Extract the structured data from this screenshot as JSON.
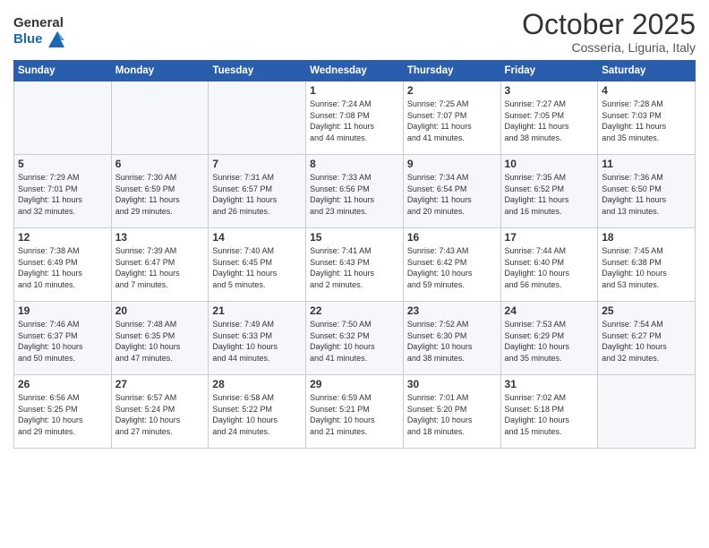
{
  "header": {
    "logo_general": "General",
    "logo_blue": "Blue",
    "month": "October 2025",
    "location": "Cosseria, Liguria, Italy"
  },
  "weekdays": [
    "Sunday",
    "Monday",
    "Tuesday",
    "Wednesday",
    "Thursday",
    "Friday",
    "Saturday"
  ],
  "weeks": [
    [
      {
        "day": "",
        "info": ""
      },
      {
        "day": "",
        "info": ""
      },
      {
        "day": "",
        "info": ""
      },
      {
        "day": "1",
        "info": "Sunrise: 7:24 AM\nSunset: 7:08 PM\nDaylight: 11 hours\nand 44 minutes."
      },
      {
        "day": "2",
        "info": "Sunrise: 7:25 AM\nSunset: 7:07 PM\nDaylight: 11 hours\nand 41 minutes."
      },
      {
        "day": "3",
        "info": "Sunrise: 7:27 AM\nSunset: 7:05 PM\nDaylight: 11 hours\nand 38 minutes."
      },
      {
        "day": "4",
        "info": "Sunrise: 7:28 AM\nSunset: 7:03 PM\nDaylight: 11 hours\nand 35 minutes."
      }
    ],
    [
      {
        "day": "5",
        "info": "Sunrise: 7:29 AM\nSunset: 7:01 PM\nDaylight: 11 hours\nand 32 minutes."
      },
      {
        "day": "6",
        "info": "Sunrise: 7:30 AM\nSunset: 6:59 PM\nDaylight: 11 hours\nand 29 minutes."
      },
      {
        "day": "7",
        "info": "Sunrise: 7:31 AM\nSunset: 6:57 PM\nDaylight: 11 hours\nand 26 minutes."
      },
      {
        "day": "8",
        "info": "Sunrise: 7:33 AM\nSunset: 6:56 PM\nDaylight: 11 hours\nand 23 minutes."
      },
      {
        "day": "9",
        "info": "Sunrise: 7:34 AM\nSunset: 6:54 PM\nDaylight: 11 hours\nand 20 minutes."
      },
      {
        "day": "10",
        "info": "Sunrise: 7:35 AM\nSunset: 6:52 PM\nDaylight: 11 hours\nand 16 minutes."
      },
      {
        "day": "11",
        "info": "Sunrise: 7:36 AM\nSunset: 6:50 PM\nDaylight: 11 hours\nand 13 minutes."
      }
    ],
    [
      {
        "day": "12",
        "info": "Sunrise: 7:38 AM\nSunset: 6:49 PM\nDaylight: 11 hours\nand 10 minutes."
      },
      {
        "day": "13",
        "info": "Sunrise: 7:39 AM\nSunset: 6:47 PM\nDaylight: 11 hours\nand 7 minutes."
      },
      {
        "day": "14",
        "info": "Sunrise: 7:40 AM\nSunset: 6:45 PM\nDaylight: 11 hours\nand 5 minutes."
      },
      {
        "day": "15",
        "info": "Sunrise: 7:41 AM\nSunset: 6:43 PM\nDaylight: 11 hours\nand 2 minutes."
      },
      {
        "day": "16",
        "info": "Sunrise: 7:43 AM\nSunset: 6:42 PM\nDaylight: 10 hours\nand 59 minutes."
      },
      {
        "day": "17",
        "info": "Sunrise: 7:44 AM\nSunset: 6:40 PM\nDaylight: 10 hours\nand 56 minutes."
      },
      {
        "day": "18",
        "info": "Sunrise: 7:45 AM\nSunset: 6:38 PM\nDaylight: 10 hours\nand 53 minutes."
      }
    ],
    [
      {
        "day": "19",
        "info": "Sunrise: 7:46 AM\nSunset: 6:37 PM\nDaylight: 10 hours\nand 50 minutes."
      },
      {
        "day": "20",
        "info": "Sunrise: 7:48 AM\nSunset: 6:35 PM\nDaylight: 10 hours\nand 47 minutes."
      },
      {
        "day": "21",
        "info": "Sunrise: 7:49 AM\nSunset: 6:33 PM\nDaylight: 10 hours\nand 44 minutes."
      },
      {
        "day": "22",
        "info": "Sunrise: 7:50 AM\nSunset: 6:32 PM\nDaylight: 10 hours\nand 41 minutes."
      },
      {
        "day": "23",
        "info": "Sunrise: 7:52 AM\nSunset: 6:30 PM\nDaylight: 10 hours\nand 38 minutes."
      },
      {
        "day": "24",
        "info": "Sunrise: 7:53 AM\nSunset: 6:29 PM\nDaylight: 10 hours\nand 35 minutes."
      },
      {
        "day": "25",
        "info": "Sunrise: 7:54 AM\nSunset: 6:27 PM\nDaylight: 10 hours\nand 32 minutes."
      }
    ],
    [
      {
        "day": "26",
        "info": "Sunrise: 6:56 AM\nSunset: 5:25 PM\nDaylight: 10 hours\nand 29 minutes."
      },
      {
        "day": "27",
        "info": "Sunrise: 6:57 AM\nSunset: 5:24 PM\nDaylight: 10 hours\nand 27 minutes."
      },
      {
        "day": "28",
        "info": "Sunrise: 6:58 AM\nSunset: 5:22 PM\nDaylight: 10 hours\nand 24 minutes."
      },
      {
        "day": "29",
        "info": "Sunrise: 6:59 AM\nSunset: 5:21 PM\nDaylight: 10 hours\nand 21 minutes."
      },
      {
        "day": "30",
        "info": "Sunrise: 7:01 AM\nSunset: 5:20 PM\nDaylight: 10 hours\nand 18 minutes."
      },
      {
        "day": "31",
        "info": "Sunrise: 7:02 AM\nSunset: 5:18 PM\nDaylight: 10 hours\nand 15 minutes."
      },
      {
        "day": "",
        "info": ""
      }
    ]
  ]
}
